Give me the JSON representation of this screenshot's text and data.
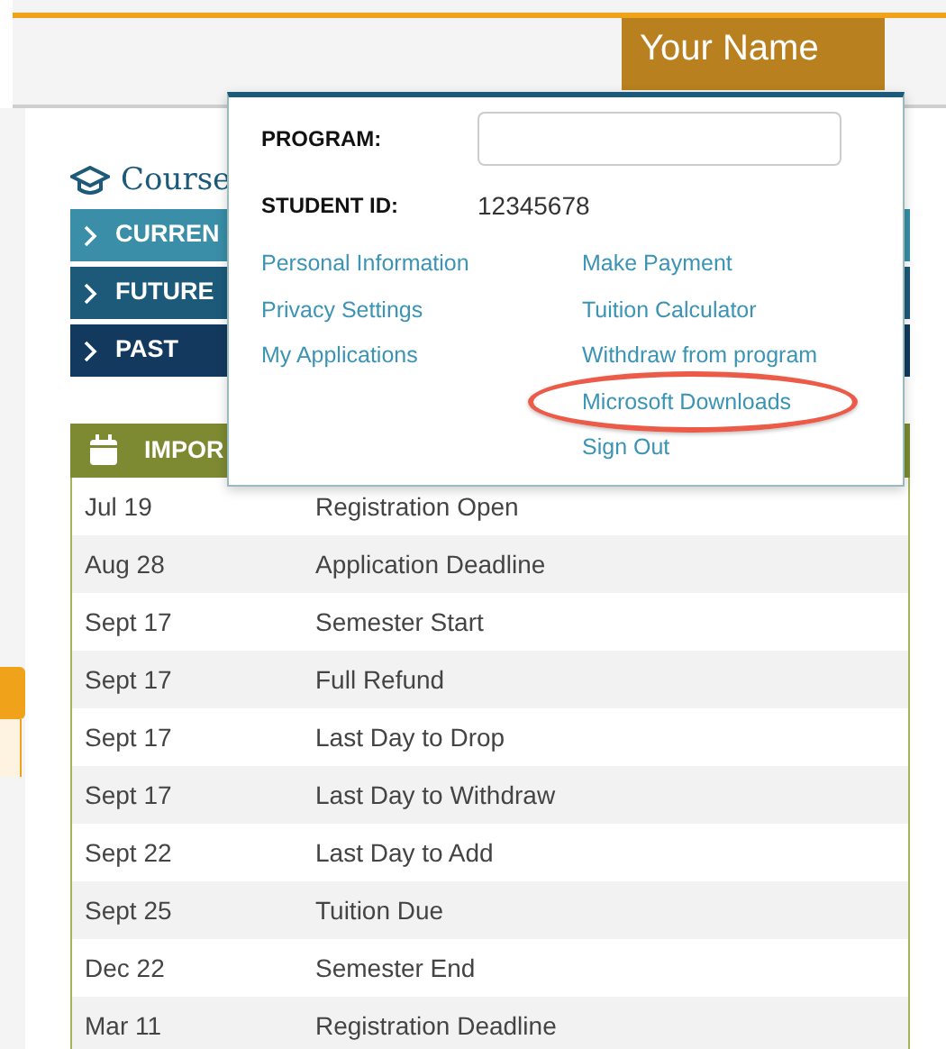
{
  "header": {
    "user_name": "Your Name"
  },
  "account_menu": {
    "program": {
      "label": "PROGRAM:"
    },
    "student_id": {
      "label": "STUDENT ID:",
      "value": "12345678"
    },
    "links_left": [
      {
        "label": "Personal Information"
      },
      {
        "label": "Privacy Settings"
      },
      {
        "label": "My Applications"
      }
    ],
    "links_right": [
      {
        "label": "Make Payment",
        "highlighted": false
      },
      {
        "label": "Tuition Calculator",
        "highlighted": false
      },
      {
        "label": "Withdraw from program",
        "highlighted": false
      },
      {
        "label": "Microsoft Downloads",
        "highlighted": true
      },
      {
        "label": "Sign Out",
        "highlighted": false
      }
    ]
  },
  "courses": {
    "title": "Course",
    "sections": [
      {
        "label": "CURREN",
        "color": "#3a8ea8"
      },
      {
        "label": "FUTURE",
        "color": "#1d5a7a"
      },
      {
        "label": "PAST",
        "color": "#133a5e"
      }
    ]
  },
  "important_dates": {
    "title": "IMPOR",
    "rows": [
      {
        "date": "Jul 19",
        "event": "Registration Open"
      },
      {
        "date": "Aug 28",
        "event": "Application Deadline"
      },
      {
        "date": "Sept 17",
        "event": "Semester Start"
      },
      {
        "date": "Sept 17",
        "event": "Full Refund"
      },
      {
        "date": "Sept 17",
        "event": "Last Day to Drop"
      },
      {
        "date": "Sept 17",
        "event": "Last Day to Withdraw"
      },
      {
        "date": "Sept 22",
        "event": "Last Day to Add"
      },
      {
        "date": "Sept 25",
        "event": "Tuition Due"
      },
      {
        "date": "Dec 22",
        "event": "Semester End"
      },
      {
        "date": "Mar 11",
        "event": "Registration Deadline"
      }
    ]
  }
}
